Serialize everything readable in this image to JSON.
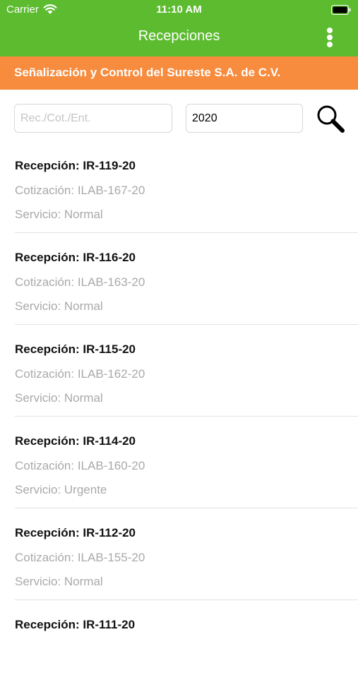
{
  "status_bar": {
    "carrier": "Carrier",
    "time": "11:10 AM"
  },
  "nav": {
    "title": "Recepciones",
    "menu_icon": "more-vertical-icon"
  },
  "banner": {
    "company": "Señalización y Control del Sureste S.A. de C.V."
  },
  "search": {
    "query_placeholder": "Rec./Cot./Ent.",
    "query_value": "",
    "year_value": "2020",
    "button_icon": "search-icon"
  },
  "colors": {
    "header_green": "#5cbb2f",
    "banner_orange": "#f78b3e",
    "subtitle_gray": "#a9a9a9"
  },
  "items": [
    {
      "title": "Recepción: IR-119-20",
      "quote": "Cotización: ILAB-167-20",
      "service": "Servicio: Normal"
    },
    {
      "title": "Recepción: IR-116-20",
      "quote": "Cotización: ILAB-163-20",
      "service": "Servicio: Normal"
    },
    {
      "title": "Recepción: IR-115-20",
      "quote": "Cotización: ILAB-162-20",
      "service": "Servicio: Normal"
    },
    {
      "title": "Recepción: IR-114-20",
      "quote": "Cotización: ILAB-160-20",
      "service": "Servicio: Urgente"
    },
    {
      "title": "Recepción: IR-112-20",
      "quote": "Cotización: ILAB-155-20",
      "service": "Servicio: Normal"
    },
    {
      "title": "Recepción: IR-111-20"
    }
  ]
}
